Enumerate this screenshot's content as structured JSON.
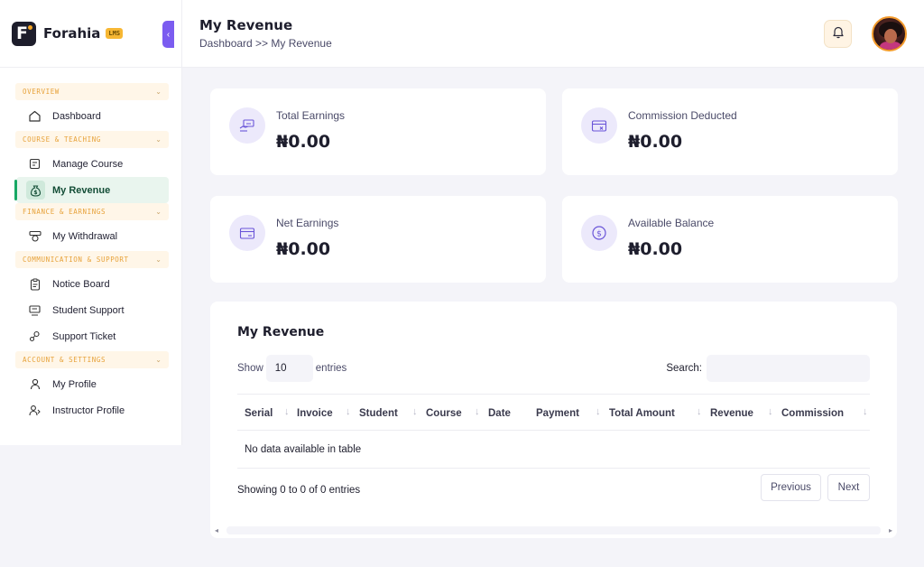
{
  "brand": {
    "name": "Forahia",
    "badge": "LMS"
  },
  "sidebar": {
    "sections": [
      {
        "label": "OVERVIEW",
        "items": [
          {
            "label": "Dashboard",
            "icon": "home-icon"
          }
        ]
      },
      {
        "label": "COURSE & TEACHING",
        "items": [
          {
            "label": "Manage Course",
            "icon": "course-icon"
          },
          {
            "label": "My Revenue",
            "icon": "money-bag-icon",
            "active": true
          }
        ]
      },
      {
        "label": "FINANCE & EARNINGS",
        "items": [
          {
            "label": "My Withdrawal",
            "icon": "withdrawal-icon"
          }
        ]
      },
      {
        "label": "COMMUNICATION & SUPPORT",
        "items": [
          {
            "label": "Notice Board",
            "icon": "clipboard-icon"
          },
          {
            "label": "Student Support",
            "icon": "support-icon"
          },
          {
            "label": "Support Ticket",
            "icon": "ticket-icon"
          }
        ]
      },
      {
        "label": "ACCOUNT & SETTINGS",
        "items": [
          {
            "label": "My Profile",
            "icon": "user-icon"
          },
          {
            "label": "Instructor Profile",
            "icon": "instructor-icon"
          }
        ]
      }
    ]
  },
  "header": {
    "title": "My Revenue",
    "breadcrumb": "Dashboard >> My Revenue"
  },
  "stats": [
    {
      "label": "Total Earnings",
      "value": "₦0.00",
      "icon": "earnings-icon"
    },
    {
      "label": "Commission Deducted",
      "value": "₦0.00",
      "icon": "commission-icon"
    },
    {
      "label": "Net Earnings",
      "value": "₦0.00",
      "icon": "card-icon"
    },
    {
      "label": "Available Balance",
      "value": "₦0.00",
      "icon": "dollar-coin-icon"
    }
  ],
  "table": {
    "title": "My Revenue",
    "show_label": "Show",
    "entries_value": "10",
    "entries_label": "entries",
    "search_label": "Search:",
    "columns": [
      "Serial",
      "Invoice",
      "Student",
      "Course",
      "Date",
      "Payment",
      "Total Amount",
      "Revenue",
      "Commission"
    ],
    "empty_text": "No data available in table",
    "info": "Showing 0 to 0 of 0 entries",
    "prev_label": "Previous",
    "next_label": "Next"
  },
  "colors": {
    "accent": "#7b5cf0",
    "active_green": "#17a864",
    "section_bg": "#fff6e8",
    "section_text": "#e7a23a"
  }
}
